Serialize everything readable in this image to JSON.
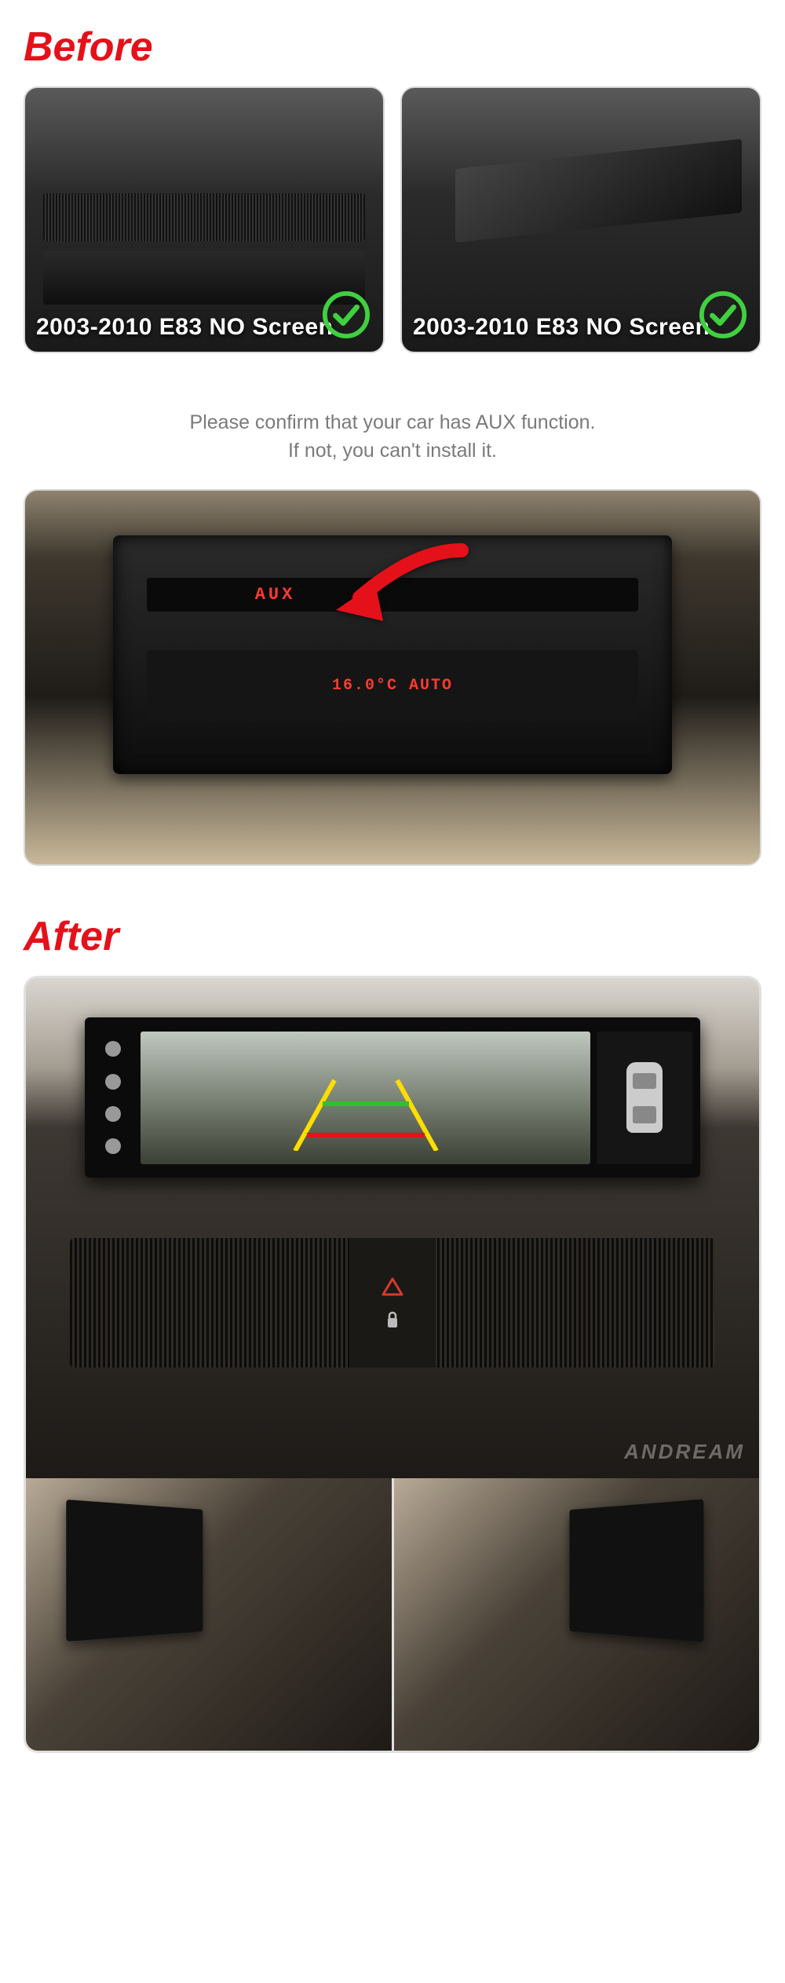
{
  "sections": {
    "before_title": "Before",
    "after_title": "After"
  },
  "before_cards": [
    {
      "caption": "2003-2010 E83 NO Screen"
    },
    {
      "caption": "2003-2010 E83 NO Screen"
    }
  ],
  "disclaimer": {
    "line1": "Please confirm that your car has AUX function.",
    "line2": "If not, you can't install it."
  },
  "aux_panel": {
    "aux_text": "AUX",
    "temp_text": "16.0°C AUTO"
  },
  "watermark": "ANDREAM"
}
